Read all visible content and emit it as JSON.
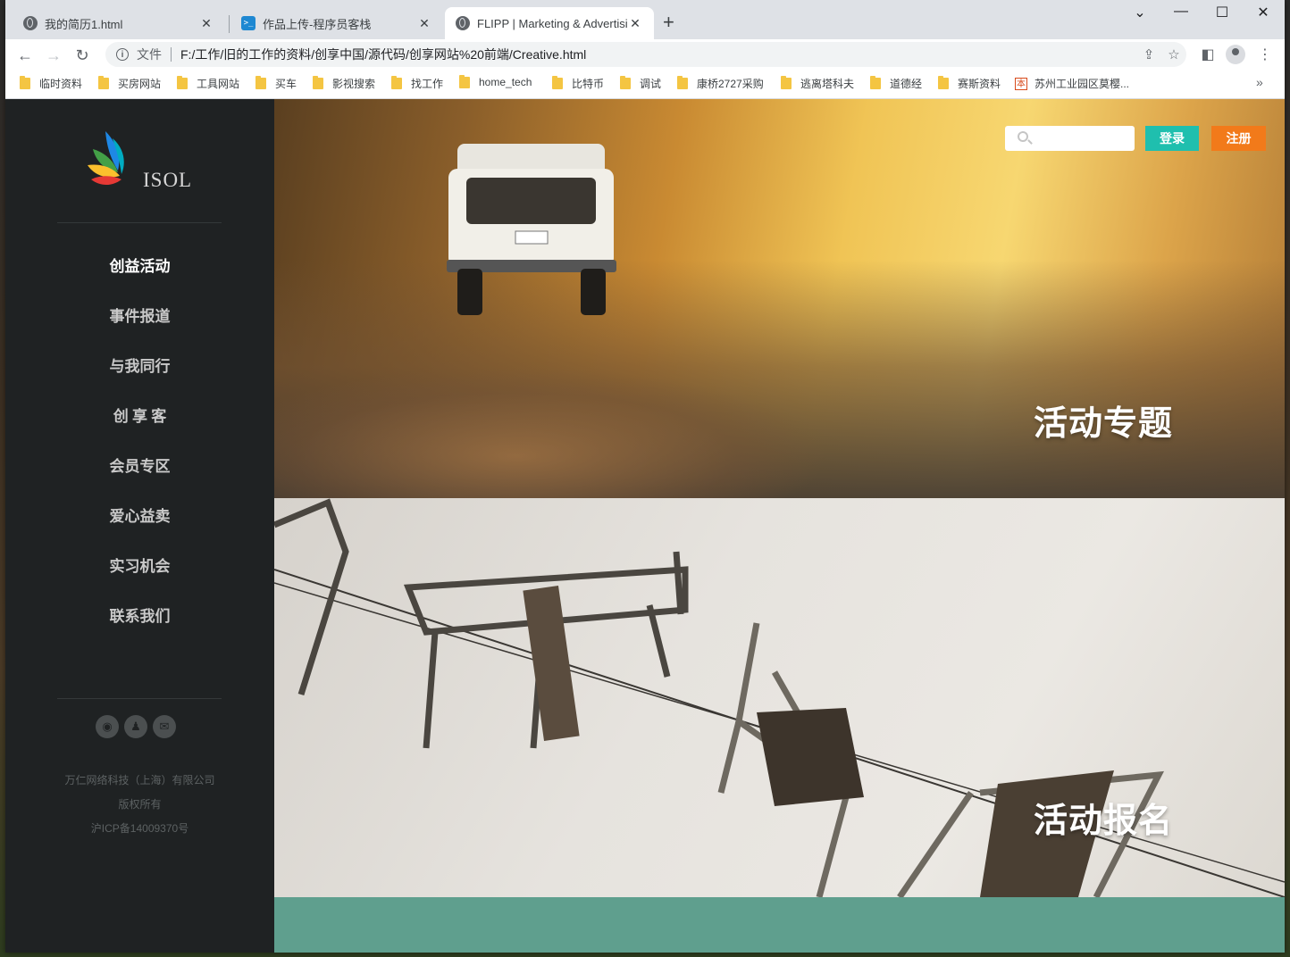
{
  "browser": {
    "tabs": [
      {
        "title": "我的简历1.html",
        "favicon": "globe-icon",
        "active": false
      },
      {
        "title": "作品上传-程序员客栈",
        "favicon": "powershell-icon",
        "active": false
      },
      {
        "title": "FLIPP | Marketing & Advertising",
        "favicon": "globe-icon",
        "active": true
      }
    ],
    "new_tab": "+",
    "window_controls": [
      "⌄",
      "—",
      "☐",
      "✕"
    ],
    "address": {
      "scheme_label": "文件",
      "url": "F:/工作/旧的工作的资料/创享中国/源代码/创享网站%20前端/Creative.html"
    },
    "bookmarks": [
      "临时资料",
      "买房网站",
      "工具网站",
      "买车",
      "影视搜索",
      "找工作",
      "home_tech",
      "比特币",
      "调试",
      "康桥2727采购",
      "逃离塔科夫",
      "道德经",
      "赛斯资料",
      "苏州工业园区莫樱..."
    ],
    "bookmarks_more": "»"
  },
  "site": {
    "logo_text": "ISOL",
    "nav": [
      "创益活动",
      "事件报道",
      "与我同行",
      "创 享 客",
      "会员专区",
      "爱心益卖",
      "实习机会",
      "联系我们"
    ],
    "active_nav": "创益活动",
    "socials": [
      "weibo-icon",
      "qq-icon",
      "wechat-icon"
    ],
    "footer": {
      "company": "万仁网络科技（上海）有限公司",
      "rights": "版权所有",
      "icp": "沪ICP备14009370号"
    },
    "header": {
      "search_placeholder": "",
      "login": "登录",
      "register": "注册"
    },
    "sections": [
      {
        "title": "活动专题"
      },
      {
        "title": "活动报名"
      }
    ],
    "colors": {
      "login": "#1fbfae",
      "register": "#f27a1a",
      "sidebar": "#1f2223",
      "band": "#5f9f8e"
    }
  }
}
